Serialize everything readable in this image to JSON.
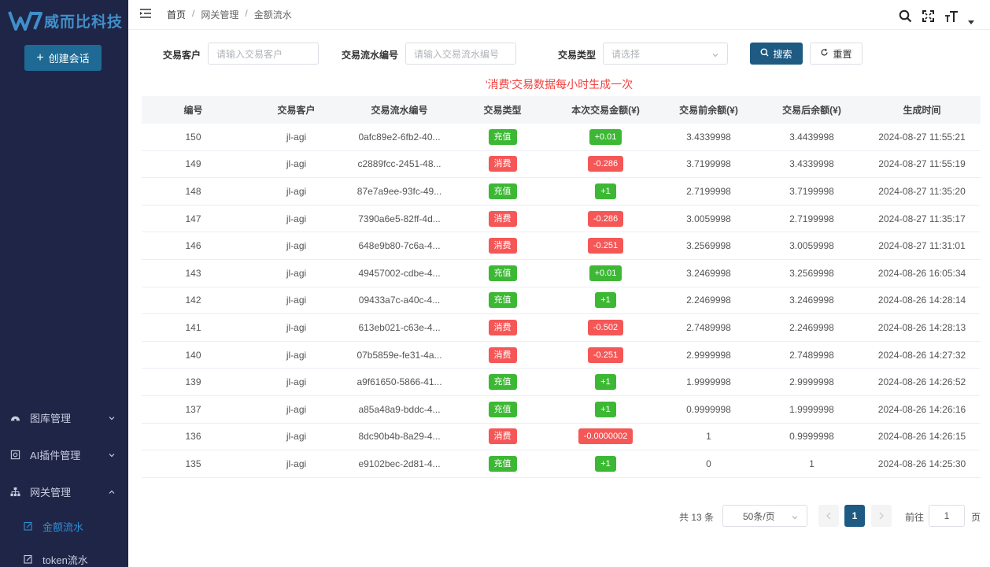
{
  "brand": {
    "name": "威而比科技"
  },
  "sidebar": {
    "create_label": "创建会话",
    "items": [
      {
        "label": "图库管理",
        "icon": "dashboard-icon",
        "expanded": false
      },
      {
        "label": "AI插件管理",
        "icon": "plugin-icon",
        "expanded": false
      },
      {
        "label": "网关管理",
        "icon": "sitemap-icon",
        "expanded": true
      }
    ],
    "subitems": [
      {
        "label": "金额流水",
        "icon": "edit-icon",
        "active": true
      },
      {
        "label": "token流水",
        "icon": "edit-icon",
        "active": false
      }
    ]
  },
  "header": {
    "breadcrumb": [
      "首页",
      "网关管理",
      "金额流水"
    ]
  },
  "filters": {
    "customer_label": "交易客户",
    "customer_placeholder": "请输入交易客户",
    "serial_label": "交易流水编号",
    "serial_placeholder": "请输入交易流水编号",
    "type_label": "交易类型",
    "type_placeholder": "请选择",
    "search_label": "搜索",
    "reset_label": "重置"
  },
  "notice": "'消费'交易数据每小时生成一次",
  "table": {
    "headers": [
      "编号",
      "交易客户",
      "交易流水编号",
      "交易类型",
      "本次交易金额(¥)",
      "交易前余额(¥)",
      "交易后余额(¥)",
      "生成时间"
    ],
    "rows": [
      {
        "id": "150",
        "customer": "jl-agi",
        "serial": "0afc89e2-6fb2-40...",
        "type": "充值",
        "amount": "+0.01",
        "before": "3.4339998",
        "after": "3.4439998",
        "time": "2024-08-27 11:55:21"
      },
      {
        "id": "149",
        "customer": "jl-agi",
        "serial": "c2889fcc-2451-48...",
        "type": "消费",
        "amount": "-0.286",
        "before": "3.7199998",
        "after": "3.4339998",
        "time": "2024-08-27 11:55:19"
      },
      {
        "id": "148",
        "customer": "jl-agi",
        "serial": "87e7a9ee-93fc-49...",
        "type": "充值",
        "amount": "+1",
        "before": "2.7199998",
        "after": "3.7199998",
        "time": "2024-08-27 11:35:20"
      },
      {
        "id": "147",
        "customer": "jl-agi",
        "serial": "7390a6e5-82ff-4d...",
        "type": "消费",
        "amount": "-0.286",
        "before": "3.0059998",
        "after": "2.7199998",
        "time": "2024-08-27 11:35:17"
      },
      {
        "id": "146",
        "customer": "jl-agi",
        "serial": "648e9b80-7c6a-4...",
        "type": "消费",
        "amount": "-0.251",
        "before": "3.2569998",
        "after": "3.0059998",
        "time": "2024-08-27 11:31:01"
      },
      {
        "id": "143",
        "customer": "jl-agi",
        "serial": "49457002-cdbe-4...",
        "type": "充值",
        "amount": "+0.01",
        "before": "3.2469998",
        "after": "3.2569998",
        "time": "2024-08-26 16:05:34"
      },
      {
        "id": "142",
        "customer": "jl-agi",
        "serial": "09433a7c-a40c-4...",
        "type": "充值",
        "amount": "+1",
        "before": "2.2469998",
        "after": "3.2469998",
        "time": "2024-08-26 14:28:14"
      },
      {
        "id": "141",
        "customer": "jl-agi",
        "serial": "613eb021-c63e-4...",
        "type": "消费",
        "amount": "-0.502",
        "before": "2.7489998",
        "after": "2.2469998",
        "time": "2024-08-26 14:28:13"
      },
      {
        "id": "140",
        "customer": "jl-agi",
        "serial": "07b5859e-fe31-4a...",
        "type": "消费",
        "amount": "-0.251",
        "before": "2.9999998",
        "after": "2.7489998",
        "time": "2024-08-26 14:27:32"
      },
      {
        "id": "139",
        "customer": "jl-agi",
        "serial": "a9f61650-5866-41...",
        "type": "充值",
        "amount": "+1",
        "before": "1.9999998",
        "after": "2.9999998",
        "time": "2024-08-26 14:26:52"
      },
      {
        "id": "137",
        "customer": "jl-agi",
        "serial": "a85a48a9-bddc-4...",
        "type": "充值",
        "amount": "+1",
        "before": "0.9999998",
        "after": "1.9999998",
        "time": "2024-08-26 14:26:16"
      },
      {
        "id": "136",
        "customer": "jl-agi",
        "serial": "8dc90b4b-8a29-4...",
        "type": "消费",
        "amount": "-0.0000002",
        "before": "1",
        "after": "0.9999998",
        "time": "2024-08-26 14:26:15"
      },
      {
        "id": "135",
        "customer": "jl-agi",
        "serial": "e9102bec-2d81-4...",
        "type": "充值",
        "amount": "+1",
        "before": "0",
        "after": "1",
        "time": "2024-08-26 14:25:30"
      }
    ]
  },
  "pagination": {
    "total_text": "共 13 条",
    "page_size": "50条/页",
    "current_page": "1",
    "goto_label": "前往",
    "goto_value": "1",
    "page_suffix": "页"
  },
  "colors": {
    "sidebar_bg": "#1f2547",
    "primary": "#1e5a82",
    "recharge": "#3db835",
    "consume": "#f55757",
    "notice": "#f0413f"
  }
}
